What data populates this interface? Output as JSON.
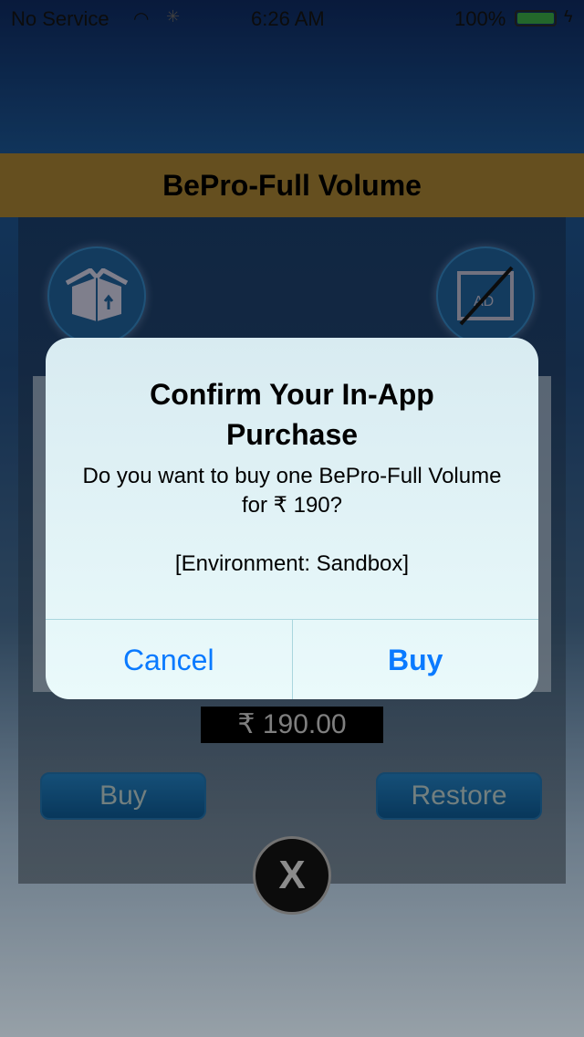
{
  "status_bar": {
    "carrier": "No Service",
    "time": "6:26 AM",
    "battery": "100%",
    "battery_color": "#2f8a3a"
  },
  "header": {
    "title": "BePro-Full Volume"
  },
  "icons": {
    "left": "open-box-icon",
    "right": "no-ads-icon"
  },
  "price": "₹ 190.00",
  "buttons": {
    "buy": "Buy",
    "restore": "Restore",
    "close": "X"
  },
  "alert": {
    "title": "Confirm Your In-App Purchase",
    "message": "Do you want to buy one BePro-Full Volume for ₹ 190?",
    "environment": "[Environment: Sandbox]",
    "cancel": "Cancel",
    "buy": "Buy",
    "accent": "#0a7aff"
  }
}
